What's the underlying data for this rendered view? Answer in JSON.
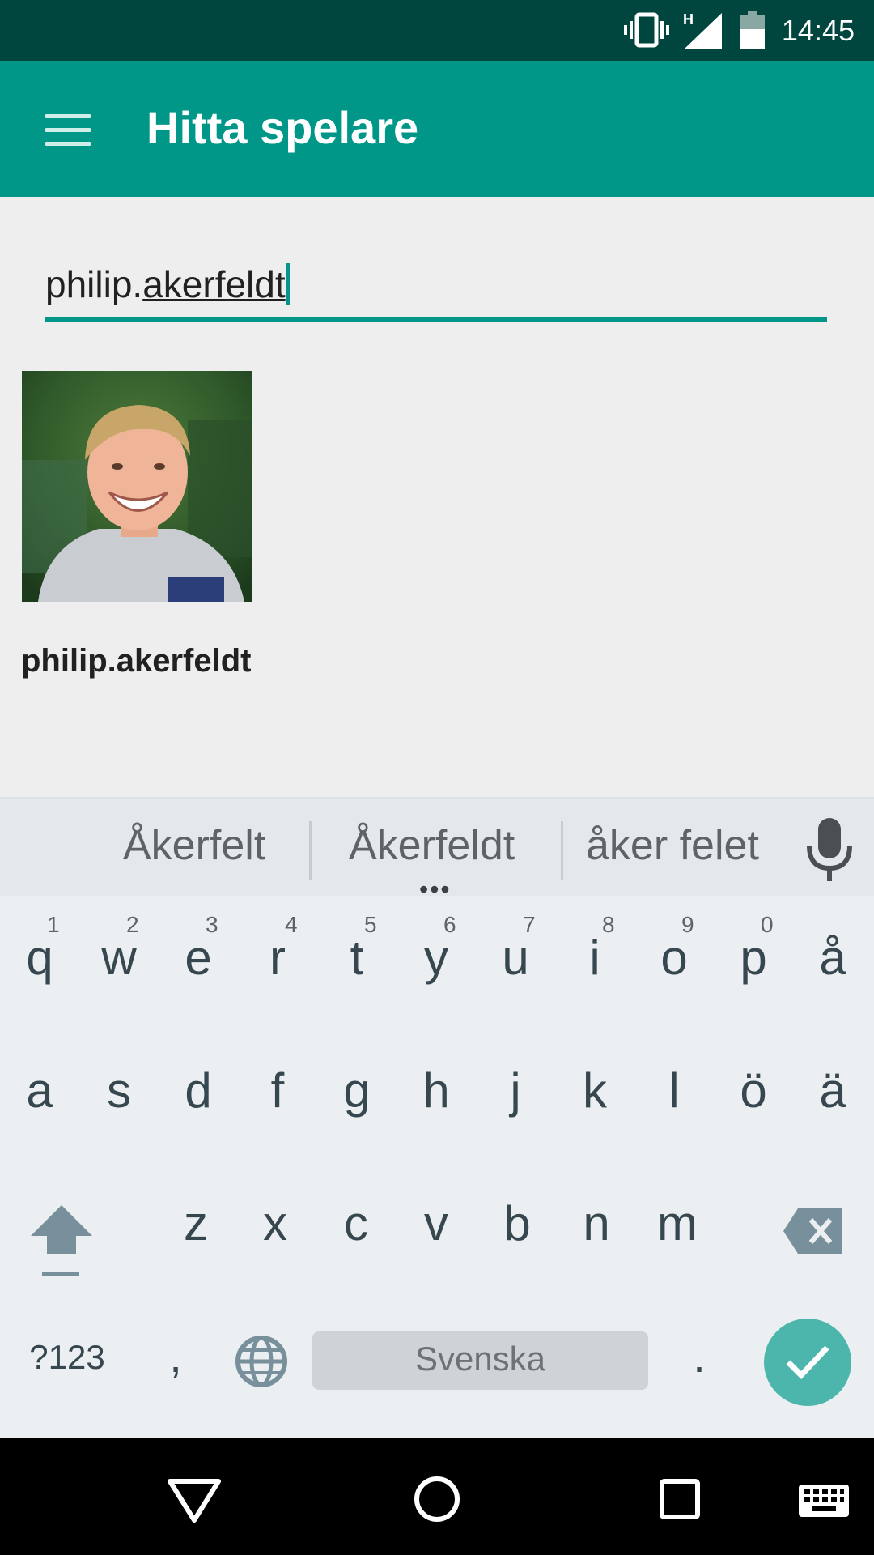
{
  "status_bar": {
    "time": "14:45",
    "network_label": "H",
    "icons": [
      "vibrate-icon",
      "signal-icon",
      "battery-icon"
    ]
  },
  "app_bar": {
    "title": "Hitta spelare",
    "menu_icon": "menu-icon"
  },
  "search": {
    "prefix": "philip.",
    "composing": "akerfeldt"
  },
  "results": [
    {
      "name": "philip.akerfeldt"
    }
  ],
  "keyboard": {
    "suggestions": [
      "Åkerfelt",
      "Åkerfeldt",
      "åker felet"
    ],
    "row1": [
      {
        "ch": "q",
        "hint": "1"
      },
      {
        "ch": "w",
        "hint": "2"
      },
      {
        "ch": "e",
        "hint": "3"
      },
      {
        "ch": "r",
        "hint": "4"
      },
      {
        "ch": "t",
        "hint": "5"
      },
      {
        "ch": "y",
        "hint": "6"
      },
      {
        "ch": "u",
        "hint": "7"
      },
      {
        "ch": "i",
        "hint": "8"
      },
      {
        "ch": "o",
        "hint": "9"
      },
      {
        "ch": "p",
        "hint": "0"
      },
      {
        "ch": "å",
        "hint": ""
      }
    ],
    "row2": [
      "a",
      "s",
      "d",
      "f",
      "g",
      "h",
      "j",
      "k",
      "l",
      "ö",
      "ä"
    ],
    "row3": [
      "z",
      "x",
      "c",
      "v",
      "b",
      "n",
      "m"
    ],
    "symbols_label": "?123",
    "comma_label": ",",
    "space_label": "Svenska",
    "period_label": ".",
    "colors": {
      "accent": "#009688",
      "action_key": "#4db6ac"
    }
  },
  "colors": {
    "status_bar": "#00463e",
    "app_bar": "#009688",
    "background": "#eeeeee"
  }
}
